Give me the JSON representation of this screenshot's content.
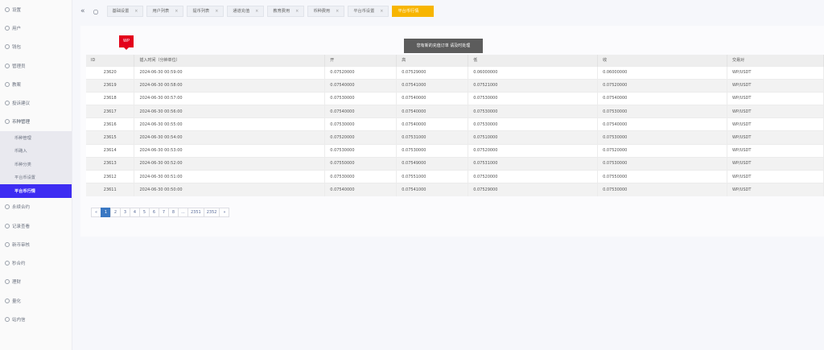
{
  "sidebar": {
    "items": [
      {
        "label": "设置",
        "icon": "gear-icon"
      },
      {
        "label": "用户",
        "icon": "user-icon"
      },
      {
        "label": "钱包",
        "icon": "wallet-icon"
      },
      {
        "label": "管理员",
        "icon": "admin-icon"
      },
      {
        "label": "教案",
        "icon": "tag-icon"
      },
      {
        "label": "投诉建议",
        "icon": "chat-icon"
      },
      {
        "label": "币种管理",
        "icon": "diamond-icon"
      }
    ],
    "sub_items": [
      {
        "label": "币种管理"
      },
      {
        "label": "币路入"
      },
      {
        "label": "币种分类"
      },
      {
        "label": "平台币设置"
      },
      {
        "label": "平台币行情"
      }
    ],
    "items_after": [
      {
        "label": "永续合约",
        "icon": "diamond-icon"
      },
      {
        "label": "记录查看",
        "icon": "record-icon"
      },
      {
        "label": "新币审核",
        "icon": "new-icon"
      },
      {
        "label": "秒合约",
        "icon": "clock-icon"
      },
      {
        "label": "理财",
        "icon": "finance-icon"
      },
      {
        "label": "量化",
        "icon": "chart-icon"
      },
      {
        "label": "站内信",
        "icon": "bell-icon"
      }
    ]
  },
  "breadcrumbs": [
    {
      "label": "基础设置"
    },
    {
      "label": "用户列表"
    },
    {
      "label": "提币列表"
    },
    {
      "label": "通道充值"
    },
    {
      "label": "教育费用"
    },
    {
      "label": "币种费用"
    },
    {
      "label": "平台币设置"
    },
    {
      "label": "平台币行情"
    }
  ],
  "logo_text": "WP",
  "toast": "您有新的充值订单 请及时处理",
  "table": {
    "headers": [
      "ID",
      "插入时间（分钟单位）",
      "开",
      "高",
      "低",
      "收",
      "交易对"
    ],
    "rows": [
      {
        "id": "23620",
        "time": "2024-06-30 00:59:00",
        "open": "0.07520000",
        "high": "0.07529000",
        "low": "0.06000000",
        "close": "0.06000000",
        "pair": "WP/USDT"
      },
      {
        "id": "23619",
        "time": "2024-06-30 00:58:00",
        "open": "0.07540000",
        "high": "0.07541000",
        "low": "0.07521000",
        "close": "0.07520000",
        "pair": "WP/USDT"
      },
      {
        "id": "23618",
        "time": "2024-06-30 00:57:00",
        "open": "0.07530000",
        "high": "0.07540000",
        "low": "0.07530000",
        "close": "0.07540000",
        "pair": "WP/USDT"
      },
      {
        "id": "23617",
        "time": "2024-06-30 00:56:00",
        "open": "0.07540000",
        "high": "0.07540000",
        "low": "0.07530000",
        "close": "0.07530000",
        "pair": "WP/USDT"
      },
      {
        "id": "23616",
        "time": "2024-06-30 00:55:00",
        "open": "0.07530000",
        "high": "0.07540000",
        "low": "0.07530000",
        "close": "0.07540000",
        "pair": "WP/USDT"
      },
      {
        "id": "23615",
        "time": "2024-06-30 00:54:00",
        "open": "0.07520000",
        "high": "0.07531000",
        "low": "0.07510000",
        "close": "0.07530000",
        "pair": "WP/USDT"
      },
      {
        "id": "23614",
        "time": "2024-06-30 00:53:00",
        "open": "0.07530000",
        "high": "0.07530000",
        "low": "0.07520000",
        "close": "0.07520000",
        "pair": "WP/USDT"
      },
      {
        "id": "23613",
        "time": "2024-06-30 00:52:00",
        "open": "0.07550000",
        "high": "0.07549000",
        "low": "0.07531000",
        "close": "0.07530000",
        "pair": "WP/USDT"
      },
      {
        "id": "23612",
        "time": "2024-06-30 00:51:00",
        "open": "0.07530000",
        "high": "0.07551000",
        "low": "0.07520000",
        "close": "0.07550000",
        "pair": "WP/USDT"
      },
      {
        "id": "23611",
        "time": "2024-06-30 00:50:00",
        "open": "0.07540000",
        "high": "0.07541000",
        "low": "0.07529000",
        "close": "0.07530000",
        "pair": "WP/USDT"
      }
    ]
  },
  "pagination": {
    "prev": "«",
    "pages": [
      "1",
      "2",
      "3",
      "4",
      "5",
      "6",
      "7",
      "8",
      "...",
      "2351",
      "2352"
    ],
    "current": "1",
    "next": "»"
  }
}
